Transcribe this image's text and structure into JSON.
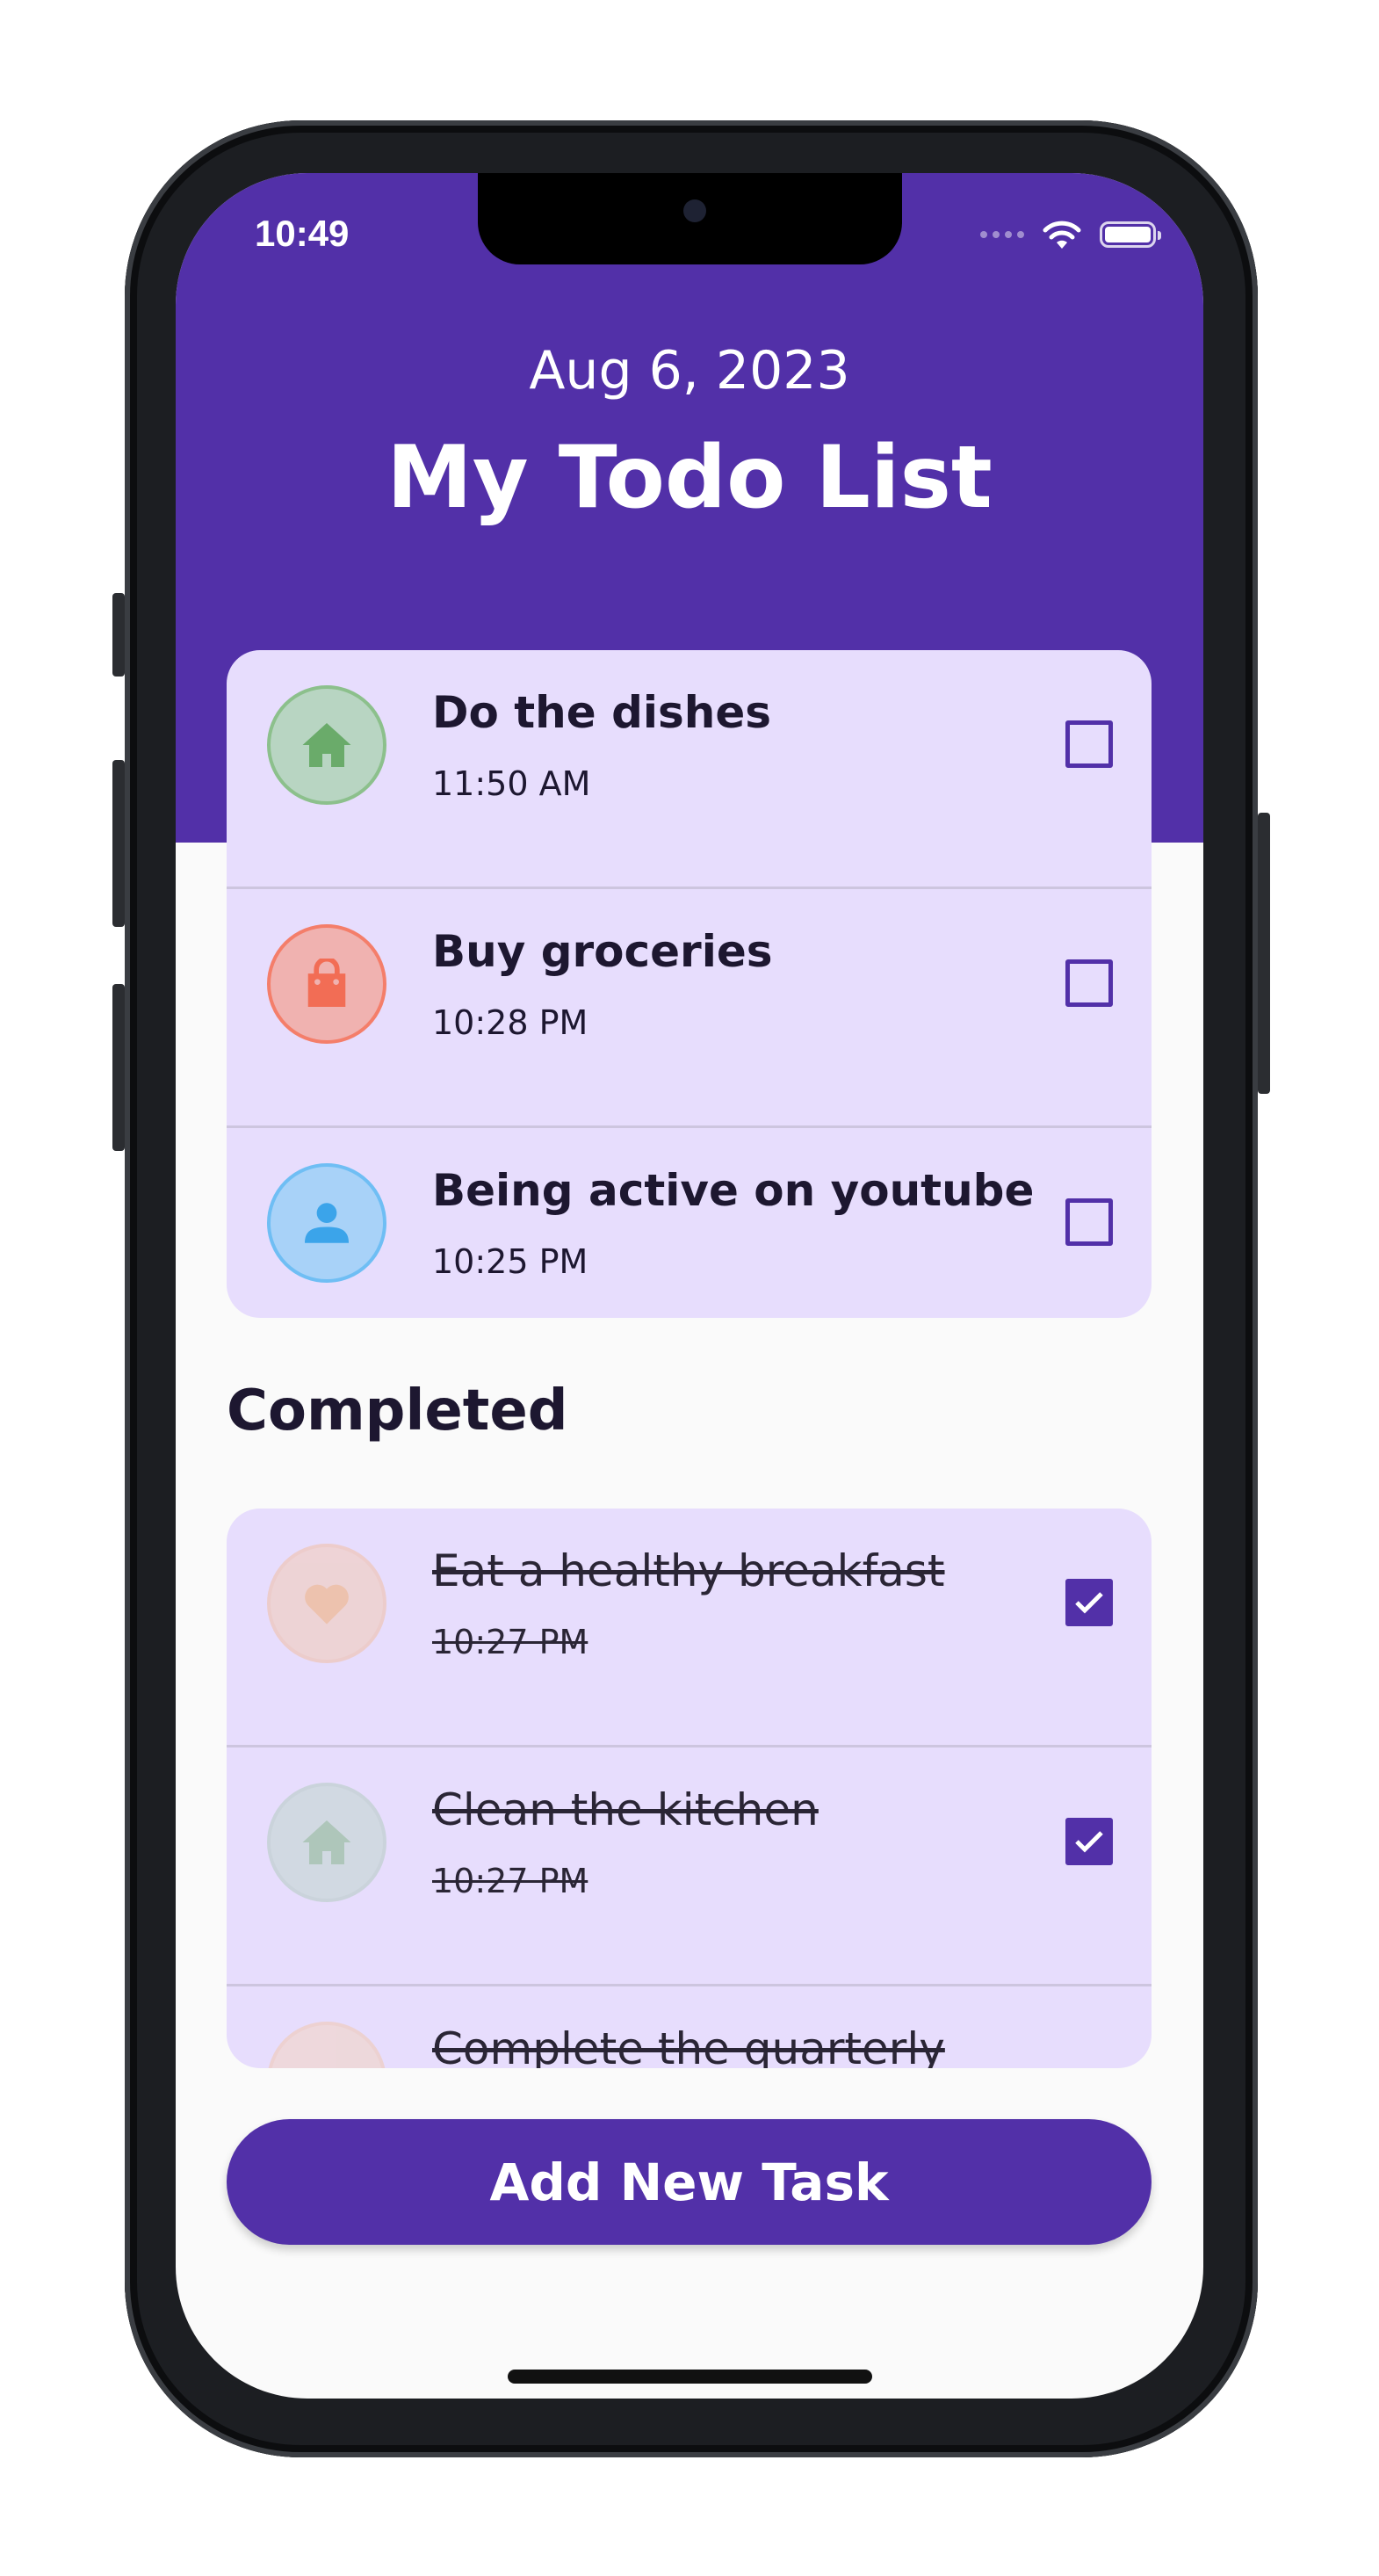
{
  "status_bar": {
    "time": "10:49",
    "icons": [
      "signal-dots-icon",
      "wifi-icon",
      "battery-icon"
    ]
  },
  "header": {
    "date": "Aug 6, 2023",
    "title": "My Todo List"
  },
  "active_tasks": [
    {
      "title": "Do the dishes",
      "time": "11:50 AM",
      "icon": "home-icon",
      "checked": false,
      "color": "#8cc08c"
    },
    {
      "title": "Buy groceries",
      "time": "10:28 PM",
      "icon": "shopping-bag-icon",
      "checked": false,
      "color": "#f47e6a"
    },
    {
      "title": "Being active on youtube",
      "time": "10:25 PM",
      "icon": "person-icon",
      "checked": false,
      "color": "#5ab3ef"
    }
  ],
  "completed_section": {
    "label": "Completed"
  },
  "completed_tasks": [
    {
      "title": "Eat a healthy breakfast",
      "time": "10:27 PM",
      "icon": "heart-icon",
      "checked": true
    },
    {
      "title": "Clean the kitchen",
      "time": "10:27 PM",
      "icon": "home-icon",
      "checked": true
    },
    {
      "title": "Complete the quarterly",
      "time": "",
      "icon": "",
      "checked": true
    }
  ],
  "add_button": {
    "label": "Add New Task"
  },
  "colors": {
    "primary": "#5230a8",
    "card": "#e7ddfd",
    "background": "#fafafa"
  }
}
